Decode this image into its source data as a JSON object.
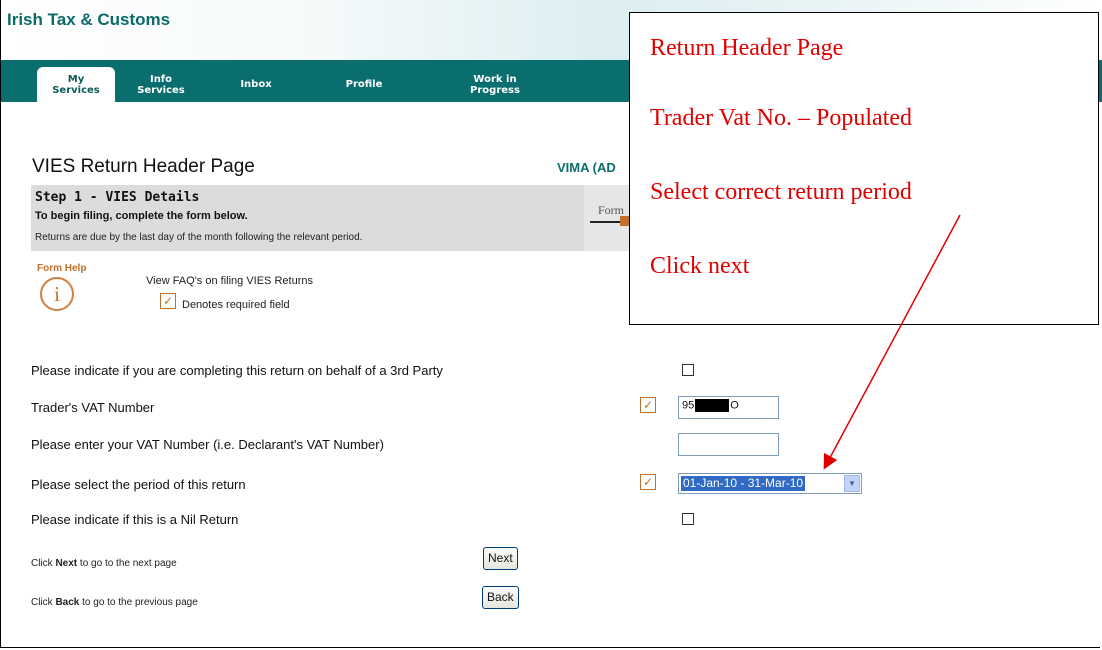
{
  "app": {
    "brand": "Irish Tax & Customs"
  },
  "nav": {
    "tabs": [
      {
        "label": "My Services",
        "active": true
      },
      {
        "label": "Info Services",
        "active": false
      },
      {
        "label": "Inbox",
        "active": false
      },
      {
        "label": "Profile",
        "active": false
      },
      {
        "label": "Work in Progress",
        "active": false
      }
    ]
  },
  "page": {
    "title": "VIES Return Header Page",
    "service_code": "VIMA (AD"
  },
  "step": {
    "title": "Step 1 - VIES Details",
    "subtitle": "To begin filing, complete the form below.",
    "note": "Returns are due by the last day of the month following the relevant period.",
    "progress_label": "Form"
  },
  "help": {
    "label": "Form Help",
    "icon": "info-icon",
    "faq_link": "View FAQ's on filing VIES Returns",
    "required_legend": "Denotes required field"
  },
  "form": {
    "third_party_label": "Please indicate if you are completing this return on behalf of a 3rd Party",
    "third_party_checked": false,
    "trader_vat_label": "Trader's VAT Number",
    "trader_vat_prefix": "95",
    "trader_vat_suffix": "O",
    "declarant_vat_label": "Please enter your VAT Number (i.e. Declarant's VAT Number)",
    "declarant_vat_value": "",
    "period_label": "Please select the period of this return",
    "period_selected": "01-Jan-10 - 31-Mar-10",
    "nil_return_label": "Please indicate if this is a Nil Return",
    "nil_return_checked": false
  },
  "actions": {
    "next_prefix": "Click ",
    "next_bold": "Next",
    "next_suffix": " to go to the next page",
    "next_button": "Next",
    "back_prefix": "Click ",
    "back_bold": "Back",
    "back_suffix": " to go to the previous page",
    "back_button": "Back"
  },
  "annotation": {
    "lines": [
      "Return Header Page",
      "Trader Vat No. – Populated",
      "Select correct return period",
      "Click next"
    ],
    "color": "#e00000"
  },
  "colors": {
    "nav": "#0b6e6e",
    "brand": "#0c6a6a",
    "accent": "#c0702a"
  }
}
